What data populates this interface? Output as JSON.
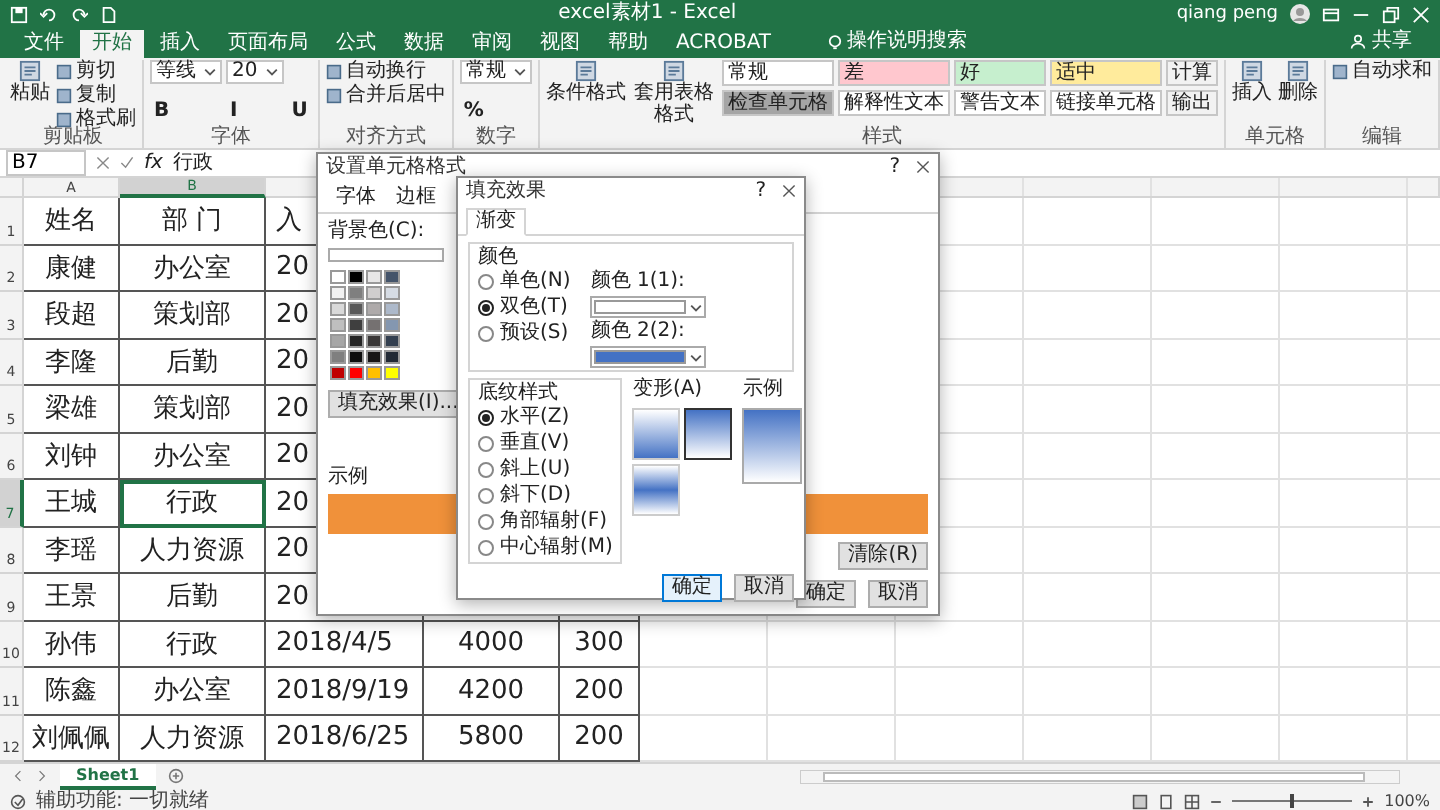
{
  "window": {
    "title": "excel素材1 - Excel",
    "user": "qiang peng"
  },
  "ribbon_tabs": [
    {
      "label": "文件",
      "selected": false
    },
    {
      "label": "开始",
      "selected": true
    },
    {
      "label": "插入",
      "selected": false
    },
    {
      "label": "页面布局",
      "selected": false
    },
    {
      "label": "公式",
      "selected": false
    },
    {
      "label": "数据",
      "selected": false
    },
    {
      "label": "审阅",
      "selected": false
    },
    {
      "label": "视图",
      "selected": false
    },
    {
      "label": "帮助",
      "selected": false
    },
    {
      "label": "ACROBAT",
      "selected": false
    }
  ],
  "tell_me": "操作说明搜索",
  "share": "共享",
  "ribbon_groups": [
    {
      "label": "剪贴板",
      "big": [
        "粘贴"
      ],
      "rows": [
        [
          {
            "kind": "small",
            "text": "剪切"
          }
        ],
        [
          {
            "kind": "small",
            "text": "复制"
          }
        ],
        [
          {
            "kind": "small",
            "text": "格式刷"
          }
        ]
      ]
    },
    {
      "label": "字体",
      "rows": [
        [
          {
            "kind": "field",
            "text": "等线"
          },
          {
            "kind": "field",
            "text": "20"
          }
        ],
        [
          {
            "kind": "glyph",
            "text": "B"
          },
          {
            "kind": "glyph",
            "text": "I"
          },
          {
            "kind": "glyph",
            "text": "U"
          }
        ]
      ]
    },
    {
      "label": "对齐方式",
      "rows": [
        [
          {
            "kind": "small",
            "text": "自动换行"
          }
        ],
        [
          {
            "kind": "small",
            "text": "合并后居中"
          }
        ]
      ]
    },
    {
      "label": "数字",
      "rows": [
        [
          {
            "kind": "field",
            "text": "常规"
          }
        ],
        [
          {
            "kind": "glyph",
            "text": "%"
          }
        ]
      ]
    },
    {
      "label": "样式",
      "big": [
        "条件格式",
        "套用表格格式"
      ],
      "rows": [
        [
          {
            "kind": "style",
            "text": "常规",
            "color": "#ffffff"
          },
          {
            "kind": "style",
            "text": "差",
            "color": "#ffc7ce"
          },
          {
            "kind": "style",
            "text": "好",
            "color": "#c6efce"
          },
          {
            "kind": "style",
            "text": "适中",
            "color": "#ffeb9c"
          },
          {
            "kind": "style",
            "text": "计算",
            "color": "#f2f2f2"
          }
        ],
        [
          {
            "kind": "style",
            "text": "检查单元格",
            "color": "#a5a5a5"
          },
          {
            "kind": "style",
            "text": "解释性文本",
            "color": "#ffffff"
          },
          {
            "kind": "style",
            "text": "警告文本",
            "color": "#ffffff"
          },
          {
            "kind": "style",
            "text": "链接单元格",
            "color": "#ffffff"
          },
          {
            "kind": "style",
            "text": "输出",
            "color": "#f2f2f2"
          }
        ]
      ]
    },
    {
      "label": "单元格",
      "big": [
        "插入",
        "删除"
      ]
    },
    {
      "label": "编辑",
      "rows": [
        [
          {
            "kind": "small",
            "text": "自动求和"
          }
        ]
      ]
    }
  ],
  "formula_bar": {
    "name_box": "B7",
    "fx": "fx",
    "value": "行政"
  },
  "sheet": {
    "columns": [
      {
        "label": "A",
        "selected": false
      },
      {
        "label": "B",
        "selected": true
      }
    ],
    "rows": [
      {
        "number": "1",
        "selected": false,
        "cells": [
          "姓名",
          "部 门",
          "入"
        ]
      },
      {
        "number": "2",
        "selected": false,
        "cells": [
          "康健",
          "办公室",
          "20"
        ]
      },
      {
        "number": "3",
        "selected": false,
        "cells": [
          "段超",
          "策划部",
          "20"
        ]
      },
      {
        "number": "4",
        "selected": false,
        "cells": [
          "李隆",
          "后勤",
          "20"
        ]
      },
      {
        "number": "5",
        "selected": false,
        "cells": [
          "梁雄",
          "策划部",
          "20"
        ]
      },
      {
        "number": "6",
        "selected": false,
        "cells": [
          "刘钟",
          "办公室",
          "20"
        ]
      },
      {
        "number": "7",
        "selected": true,
        "cells": [
          "王城",
          "行政",
          "20"
        ]
      },
      {
        "number": "8",
        "selected": false,
        "cells": [
          "李瑶",
          "人力资源",
          "20"
        ]
      },
      {
        "number": "9",
        "selected": false,
        "cells": [
          "王景",
          "后勤",
          "20"
        ]
      },
      {
        "number": "10",
        "selected": false,
        "cells": [
          "孙伟",
          "行政",
          "2018/4/5",
          "4000",
          "300"
        ]
      },
      {
        "number": "11",
        "selected": false,
        "cells": [
          "陈鑫",
          "办公室",
          "2018/9/19",
          "4200",
          "200"
        ]
      },
      {
        "number": "12",
        "selected": false,
        "cells": [
          "刘佩佩",
          "人力资源",
          "2018/6/25",
          "5800",
          "200"
        ]
      }
    ]
  },
  "sheet_tabs": [
    {
      "label": "Sheet1",
      "selected": true
    }
  ],
  "status_bar": {
    "text": "辅助功能: 一切就绪",
    "zoom": {
      "level": 0.5,
      "reading": "100%"
    }
  },
  "format_dialog": {
    "title": "设置单元格格式",
    "help": "?",
    "tabs": [
      {
        "label": "字体",
        "selected": false
      },
      {
        "label": "边框",
        "selected": false
      }
    ],
    "background_label": "背景色(C):",
    "swatches": [
      {
        "color": "#ffffff"
      },
      {
        "color": "#000000"
      },
      {
        "color": "#e7e6e6"
      },
      {
        "color": "#44546a"
      },
      {
        "color": "#f2f2f2"
      },
      {
        "color": "#7f7f7f"
      },
      {
        "color": "#d0cece"
      },
      {
        "color": "#d6dce4"
      },
      {
        "color": "#d9d9d9"
      },
      {
        "color": "#595959"
      },
      {
        "color": "#aeaaaa"
      },
      {
        "color": "#adb9ca"
      },
      {
        "color": "#bfbfbf"
      },
      {
        "color": "#3f3f3f"
      },
      {
        "color": "#757171"
      },
      {
        "color": "#8497b0"
      },
      {
        "color": "#a6a6a6"
      },
      {
        "color": "#262626"
      },
      {
        "color": "#3a3838"
      },
      {
        "color": "#333f4f"
      },
      {
        "color": "#7f7f7f"
      },
      {
        "color": "#0d0d0d"
      },
      {
        "color": "#171616"
      },
      {
        "color": "#222a35"
      },
      {
        "color": "#c00000"
      },
      {
        "color": "#ff0000"
      },
      {
        "color": "#ffc000"
      },
      {
        "color": "#ffff00"
      }
    ],
    "fill_effects_button": "填充效果(I)...",
    "sample": {
      "label": "示例",
      "color": "#f0913a"
    },
    "clear_button": "清除(R)",
    "ok_button": "确定",
    "cancel_button": "取消"
  },
  "fill_dialog": {
    "title": "填充效果",
    "help": "?",
    "tabs": [
      {
        "label": "渐变",
        "selected": true
      }
    ],
    "colors_label": "颜色",
    "color_modes": [
      {
        "label": "单色(N)",
        "selected": false
      },
      {
        "label": "双色(T)",
        "selected": true
      },
      {
        "label": "预设(S)",
        "selected": false
      }
    ],
    "color_1": {
      "label": "颜色 1(1):",
      "color": "#ffffff"
    },
    "color_2": {
      "label": "颜色 2(2):",
      "color": "#4472c4"
    },
    "shading_label": "底纹样式",
    "shading_styles": [
      {
        "label": "水平(Z)",
        "selected": true
      },
      {
        "label": "垂直(V)",
        "selected": false
      },
      {
        "label": "斜上(U)",
        "selected": false
      },
      {
        "label": "斜下(D)",
        "selected": false
      },
      {
        "label": "角部辐射(F)",
        "selected": false
      },
      {
        "label": "中心辐射(M)",
        "selected": false
      }
    ],
    "variants_label": "变形(A)",
    "variants": [
      {
        "kind": "down",
        "selected": false
      },
      {
        "kind": "up",
        "selected": true
      },
      {
        "kind": "band",
        "selected": false
      }
    ],
    "sample_label": "示例",
    "ok_button": "确定",
    "cancel_button": "取消"
  }
}
